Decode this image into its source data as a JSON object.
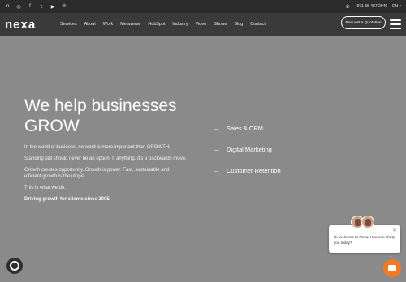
{
  "topbar": {
    "social_icons": [
      "linkedin-icon",
      "instagram-icon",
      "facebook-icon",
      "twitter-icon",
      "youtube-icon",
      "pinterest-icon"
    ],
    "social_glyphs": [
      "in",
      "◎",
      "f",
      "𝕥",
      "▶",
      "℗"
    ],
    "phone": "+971 55 487 2949",
    "language": "EN"
  },
  "navbar": {
    "logo": "nexa",
    "items": [
      "Services",
      "About",
      "Work",
      "Metaverse",
      "HubSpot",
      "Industry",
      "Video",
      "Shows",
      "Blog",
      "Contact"
    ],
    "cta": "Request a Quotation"
  },
  "hero": {
    "title_line1": "We help businesses",
    "title_line2": "GROW",
    "paragraphs": [
      "In the world of business, no word is more important than GROWTH.",
      "Standing still should never be an option. If anything, it's a backwards move.",
      "Growth creates opportunity. Growth is power. Fast, sustainable and efficient growth is the utopia.",
      "This is what we do.",
      "Driving growth for clients since 2005."
    ]
  },
  "services": [
    "Sales & CRM",
    "Digital Marketing",
    "Customer Retention"
  ],
  "chat": {
    "message": "Hi, welcome to Nexa. How can I help you today?"
  },
  "colors": {
    "background": "#8a8a8a",
    "topbar": "#2b2b2b",
    "navbar": "#3a3a3a",
    "chat_button": "#f07a23",
    "chat_close": "#3b7bd0"
  }
}
